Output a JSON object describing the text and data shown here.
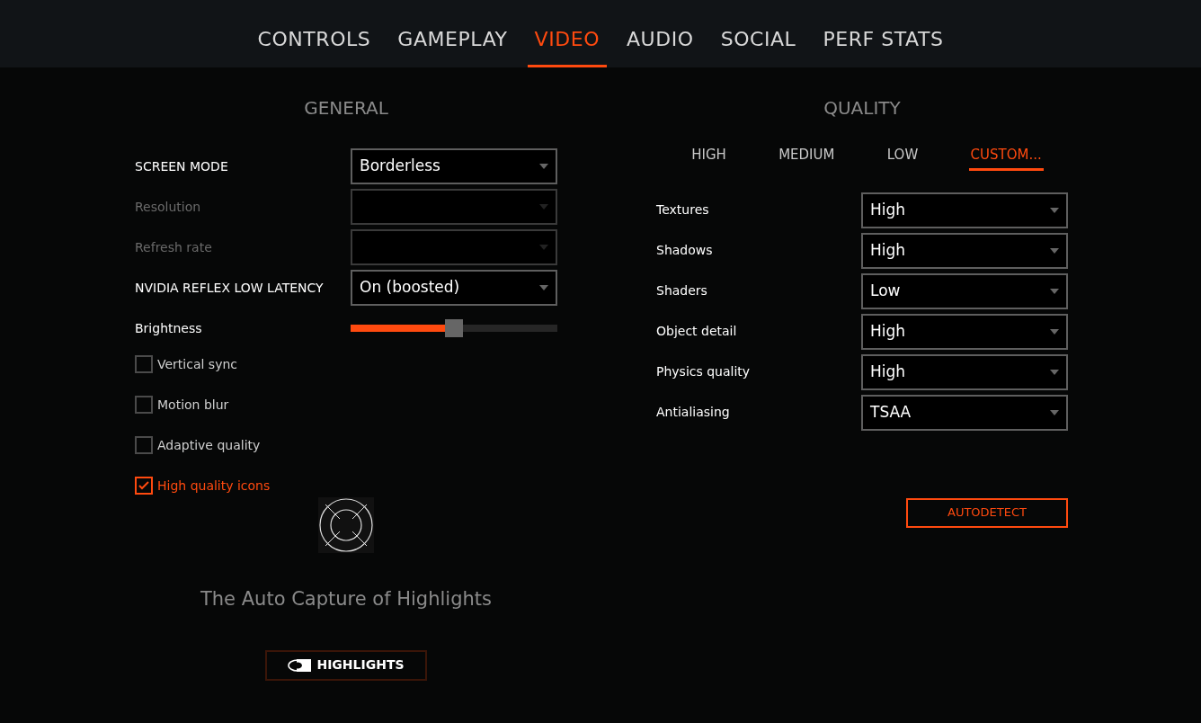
{
  "tabs": [
    {
      "label": "CONTROLS",
      "selected": false
    },
    {
      "label": "GAMEPLAY",
      "selected": false
    },
    {
      "label": "VIDEO",
      "selected": true
    },
    {
      "label": "AUDIO",
      "selected": false
    },
    {
      "label": "SOCIAL",
      "selected": false
    },
    {
      "label": "PERF STATS",
      "selected": false
    }
  ],
  "general": {
    "title": "GENERAL",
    "settings": [
      {
        "kind": "select",
        "label": "SCREEN MODE",
        "value": "Borderless",
        "disabled": false
      },
      {
        "kind": "select",
        "label": "Resolution",
        "disabled": true
      },
      {
        "kind": "select",
        "label": "Refresh rate",
        "disabled": true
      },
      {
        "kind": "select",
        "label": "NVIDIA REFLEX LOW LATENCY",
        "value": "On (boosted)",
        "disabled": false
      },
      {
        "kind": "slider",
        "label": "Brightness",
        "level": 0.5
      }
    ],
    "checkboxes": [
      {
        "label": "Vertical sync",
        "checked": false
      },
      {
        "label": "Motion blur",
        "checked": false
      },
      {
        "label": "Adaptive quality",
        "checked": false
      },
      {
        "label": "High quality icons",
        "checked": true
      }
    ],
    "caption": "The Auto Capture of Highlights",
    "highlights_button": "HIGHLIGHTS"
  },
  "quality": {
    "title": "QUALITY",
    "presets": [
      {
        "label": "HIGH",
        "selected": false
      },
      {
        "label": "MEDIUM",
        "selected": false
      },
      {
        "label": "LOW",
        "selected": false
      },
      {
        "label": "CUSTOM...",
        "selected": true
      }
    ],
    "settings": [
      {
        "label": "Textures",
        "value": "High"
      },
      {
        "label": "Shadows",
        "value": "High"
      },
      {
        "label": "Shaders",
        "value": "Low"
      },
      {
        "label": "Object detail",
        "value": "High"
      },
      {
        "label": "Physics quality",
        "value": "High"
      },
      {
        "label": "Antialiasing",
        "value": "TSAA"
      }
    ],
    "autodetect_button": "AUTODETECT"
  }
}
